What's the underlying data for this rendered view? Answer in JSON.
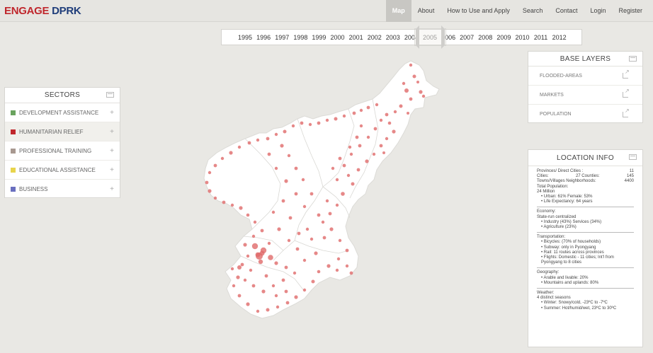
{
  "brand": {
    "part1": "ENGAGE",
    "part2": "DPRK"
  },
  "nav": [
    "Map",
    "About",
    "How to Use and Apply",
    "Search",
    "Contact",
    "Login",
    "Register"
  ],
  "years": [
    "1995",
    "1996",
    "1997",
    "1998",
    "1999",
    "2000",
    "2001",
    "2002",
    "2003",
    "2004",
    "2005",
    "2006",
    "2007",
    "2008",
    "2009",
    "2010",
    "2011",
    "2012"
  ],
  "sectors": {
    "title": "SECTORS",
    "items": [
      {
        "label": "DEVELOPMENT ASSISTANCE",
        "color": "#6aa35e",
        "plus": "+"
      },
      {
        "label": "HUMANITARIAN RELIEF",
        "color": "#c0272d",
        "plus": "+"
      },
      {
        "label": "PROFESSIONAL TRAINING",
        "color": "#a89890",
        "plus": "+"
      },
      {
        "label": "EDUCATIONAL ASSISTANCE",
        "color": "#e8d44c",
        "plus": "+"
      },
      {
        "label": "BUSINESS",
        "color": "#6a6fbf",
        "plus": "+"
      }
    ]
  },
  "base_layers": {
    "title": "BASE LAYERS",
    "items": [
      "FLOODED-AREAS",
      "MARKETS",
      "POPULATION"
    ]
  },
  "location_info": {
    "title": "LOCATION INFO",
    "provinces_label": "Provinces/ Direct Cities :",
    "provinces_value": "11",
    "cities_label": "Cities:",
    "cities_value": "27 Counties:",
    "counties_value": "145",
    "towns_label": "Towns/Villages Neighborhoods:",
    "towns_value": "4400",
    "total_pop_label": "Total Population:",
    "total_pop_value": "24 Million",
    "pop_items": [
      "Urban: 61% Female: 53%",
      "Life Expectancy: 64 years"
    ],
    "economy_label": "Economy:",
    "economy_sub": "State-run centralized",
    "economy_items": [
      "Industry (43%) Services (34%)",
      "Agriculture (23%)"
    ],
    "transport_label": "Transportation:",
    "transport_items": [
      "Bicycles: (70% of households)",
      "Subway: only in Pyongyang",
      "Rail: 11 routes across provinces",
      "Flights: Domestic - 11 cities; Int'l from Pyongyang to 8 cities"
    ],
    "geography_label": "Geography:",
    "geography_items": [
      "Arable and livable: 20%",
      "Mountains and uplands: 80%"
    ],
    "weather_label": "Weather:",
    "weather_sub": "4 distinct seasons",
    "weather_items": [
      "Winter: Snowy/cold, -23ºC to -7ºC",
      "Summer: Hot/humid/wet, 23ºC to 30ºC"
    ]
  },
  "colors": {
    "accent": "#c0272d",
    "brand_blue": "#1f3d7a",
    "marker": "#e06a6a"
  }
}
